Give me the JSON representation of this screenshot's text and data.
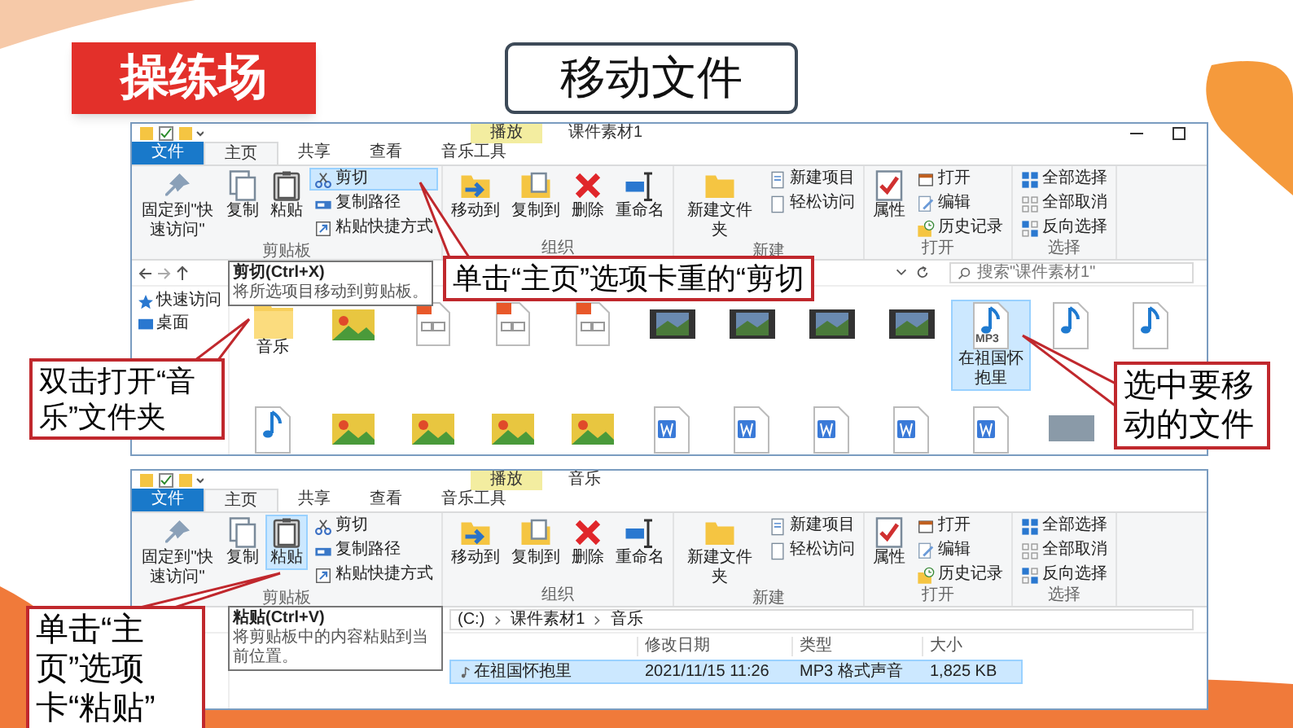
{
  "badge": {
    "text": "操练场"
  },
  "title": {
    "text": "移动文件"
  },
  "windows": [
    {
      "context_tab": "播放",
      "title": "课件素材1",
      "tabs": [
        {
          "label": "文件",
          "kind": "menu"
        },
        {
          "label": "主页",
          "kind": "tab",
          "selected": true
        },
        {
          "label": "共享",
          "kind": "tab",
          "selected": false
        },
        {
          "label": "查看",
          "kind": "tab",
          "selected": false
        },
        {
          "label": "音乐工具",
          "kind": "tab",
          "selected": false
        }
      ],
      "ribbon": [
        {
          "label": "剪贴板",
          "large": [
            {
              "label": "固定到\"快速访问\"",
              "kind": "pin",
              "selected": false
            },
            {
              "label": "复制",
              "kind": "copy",
              "selected": false
            },
            {
              "label": "粘贴",
              "kind": "paste",
              "selected": false
            }
          ],
          "small": [
            {
              "label": "剪切",
              "kind": "cut",
              "selected": true
            },
            {
              "label": "复制路径",
              "kind": "path",
              "selected": false
            },
            {
              "label": "粘贴快捷方式",
              "kind": "shortcut",
              "selected": false
            }
          ]
        },
        {
          "label": "组织",
          "large": [
            {
              "label": "移动到",
              "kind": "move",
              "selected": false
            },
            {
              "label": "复制到",
              "kind": "copyto",
              "selected": false
            },
            {
              "label": "删除",
              "kind": "delete",
              "selected": false
            },
            {
              "label": "重命名",
              "kind": "rename",
              "selected": false
            }
          ]
        },
        {
          "label": "新建",
          "large": [
            {
              "label": "新建文件夹",
              "kind": "newfolder",
              "selected": false
            }
          ],
          "small": [
            {
              "label": "新建项目",
              "kind": "newitem",
              "selected": false
            },
            {
              "label": "轻松访问",
              "kind": "access",
              "selected": false
            }
          ]
        },
        {
          "label": "打开",
          "large": [
            {
              "label": "属性",
              "kind": "properties",
              "selected": false
            }
          ],
          "small": [
            {
              "label": "打开",
              "kind": "open",
              "selected": false
            },
            {
              "label": "编辑",
              "kind": "edit",
              "selected": false
            },
            {
              "label": "历史记录",
              "kind": "history",
              "selected": false
            }
          ]
        },
        {
          "label": "选择",
          "small": [
            {
              "label": "全部选择",
              "kind": "selectall",
              "selected": false
            },
            {
              "label": "全部取消",
              "kind": "selectnone",
              "selected": false
            },
            {
              "label": "反向选择",
              "kind": "invert",
              "selected": false
            }
          ]
        }
      ],
      "tooltip": {
        "title": "剪切(Ctrl+X)",
        "text": "将所选项目移动到剪贴板。"
      },
      "search": {
        "placeholder": "搜索\"课件素材1\""
      },
      "sidebar": [
        {
          "label": "快速访问",
          "kind": "star"
        },
        {
          "label": "桌面",
          "kind": "desktop"
        }
      ],
      "files": [
        {
          "kind": "folder",
          "label": "音乐",
          "selected": false
        },
        {
          "kind": "picture",
          "selected": false
        },
        {
          "kind": "document",
          "selected": false
        },
        {
          "kind": "document",
          "selected": false
        },
        {
          "kind": "document",
          "selected": false
        },
        {
          "kind": "video",
          "selected": false
        },
        {
          "kind": "video",
          "selected": false
        },
        {
          "kind": "video",
          "selected": false
        },
        {
          "kind": "video",
          "selected": false
        },
        {
          "kind": "audio",
          "label": "在祖国怀抱里",
          "badge": "MP3",
          "selected": true
        },
        {
          "kind": "audio",
          "selected": false
        },
        {
          "kind": "audio",
          "selected": false
        },
        {
          "kind": "audio",
          "selected": false
        },
        {
          "kind": "picture",
          "selected": false
        },
        {
          "kind": "picture",
          "selected": false
        },
        {
          "kind": "picture",
          "selected": false
        },
        {
          "kind": "picture",
          "selected": false
        },
        {
          "kind": "word",
          "selected": false
        },
        {
          "kind": "word",
          "selected": false
        },
        {
          "kind": "word",
          "selected": false
        },
        {
          "kind": "word",
          "selected": false
        },
        {
          "kind": "word",
          "selected": false
        },
        {
          "kind": "photo",
          "selected": false
        }
      ]
    },
    {
      "context_tab": "播放",
      "title": "音乐",
      "tabs": [
        {
          "label": "文件",
          "kind": "menu"
        },
        {
          "label": "主页",
          "kind": "tab",
          "selected": true
        },
        {
          "label": "共享",
          "kind": "tab",
          "selected": false
        },
        {
          "label": "查看",
          "kind": "tab",
          "selected": false
        },
        {
          "label": "音乐工具",
          "kind": "tab",
          "selected": false
        }
      ],
      "ribbon": [
        {
          "label": "剪贴板",
          "large": [
            {
              "label": "固定到\"快速访问\"",
              "kind": "pin",
              "selected": false
            },
            {
              "label": "复制",
              "kind": "copy",
              "selected": false
            },
            {
              "label": "粘贴",
              "kind": "paste",
              "selected": true
            }
          ],
          "small": [
            {
              "label": "剪切",
              "kind": "cut",
              "selected": false
            },
            {
              "label": "复制路径",
              "kind": "path",
              "selected": false
            },
            {
              "label": "粘贴快捷方式",
              "kind": "shortcut",
              "selected": false
            }
          ]
        },
        {
          "label": "组织",
          "large": [
            {
              "label": "移动到",
              "kind": "move",
              "selected": false
            },
            {
              "label": "复制到",
              "kind": "copyto",
              "selected": false
            },
            {
              "label": "删除",
              "kind": "delete",
              "selected": false
            },
            {
              "label": "重命名",
              "kind": "rename",
              "selected": false
            }
          ]
        },
        {
          "label": "新建",
          "large": [
            {
              "label": "新建文件夹",
              "kind": "newfolder",
              "selected": false
            }
          ],
          "small": [
            {
              "label": "新建项目",
              "kind": "newitem",
              "selected": false
            },
            {
              "label": "轻松访问",
              "kind": "access",
              "selected": false
            }
          ]
        },
        {
          "label": "打开",
          "large": [
            {
              "label": "属性",
              "kind": "properties",
              "selected": false
            }
          ],
          "small": [
            {
              "label": "打开",
              "kind": "open",
              "selected": false
            },
            {
              "label": "编辑",
              "kind": "edit",
              "selected": false
            },
            {
              "label": "历史记录",
              "kind": "history",
              "selected": false
            }
          ]
        },
        {
          "label": "选择",
          "small": [
            {
              "label": "全部选择",
              "kind": "selectall",
              "selected": false
            },
            {
              "label": "全部取消",
              "kind": "selectnone",
              "selected": false
            },
            {
              "label": "反向选择",
              "kind": "invert",
              "selected": false
            }
          ]
        }
      ],
      "tooltip": {
        "title": "粘贴(Ctrl+V)",
        "text": "将剪贴板中的内容粘贴到当前位置。"
      },
      "breadcrumb": [
        "(C:)",
        "课件素材1",
        "音乐"
      ],
      "columns": [
        "",
        "修改日期",
        "类型",
        "大小"
      ],
      "rows": [
        {
          "cells": [
            "在祖国怀抱里",
            "2021/11/15 11:26",
            "MP3 格式声音",
            "1,825 KB"
          ],
          "selected": true
        }
      ]
    }
  ],
  "callouts": [
    {
      "text": "单击“主页”选项卡重的“剪切"
    },
    {
      "text": "双击打开“音乐”文件夹"
    },
    {
      "text": "选中要移动的文件"
    },
    {
      "text": "单击“主页”选项卡“粘贴”"
    }
  ]
}
